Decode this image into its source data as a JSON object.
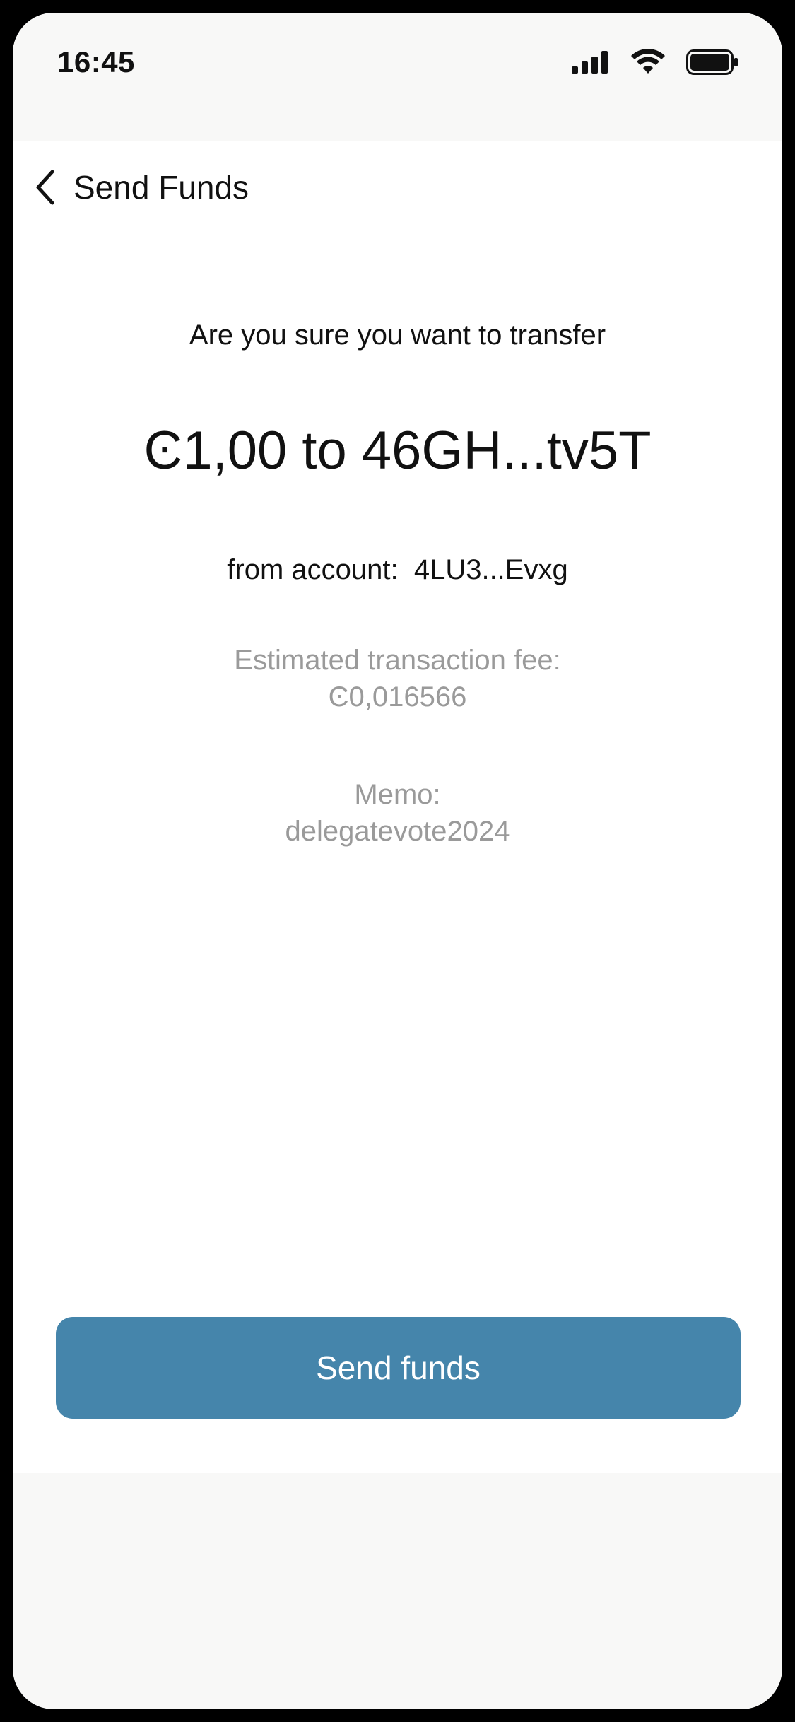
{
  "status_bar": {
    "time": "16:45",
    "icons": [
      "cellular-signal-icon",
      "wifi-icon",
      "battery-icon"
    ]
  },
  "nav": {
    "back_icon": "chevron-left-icon",
    "title": "Send Funds"
  },
  "confirmation": {
    "prompt": "Are you sure you want to transfer",
    "amount_line": "Ͼ1,00 to 46GH...tv5T",
    "from_label": "from account:",
    "from_account": "4LU3...Evxg",
    "fee_label": "Estimated transaction fee:",
    "fee_value": "Ͼ0,016566",
    "memo_label": "Memo:",
    "memo_value": "delegatevote2024"
  },
  "actions": {
    "send_label": "Send funds"
  },
  "colors": {
    "accent": "#4585ab",
    "muted_text": "#9a9a9a",
    "background": "#f8f8f7",
    "content_background": "#ffffff"
  }
}
